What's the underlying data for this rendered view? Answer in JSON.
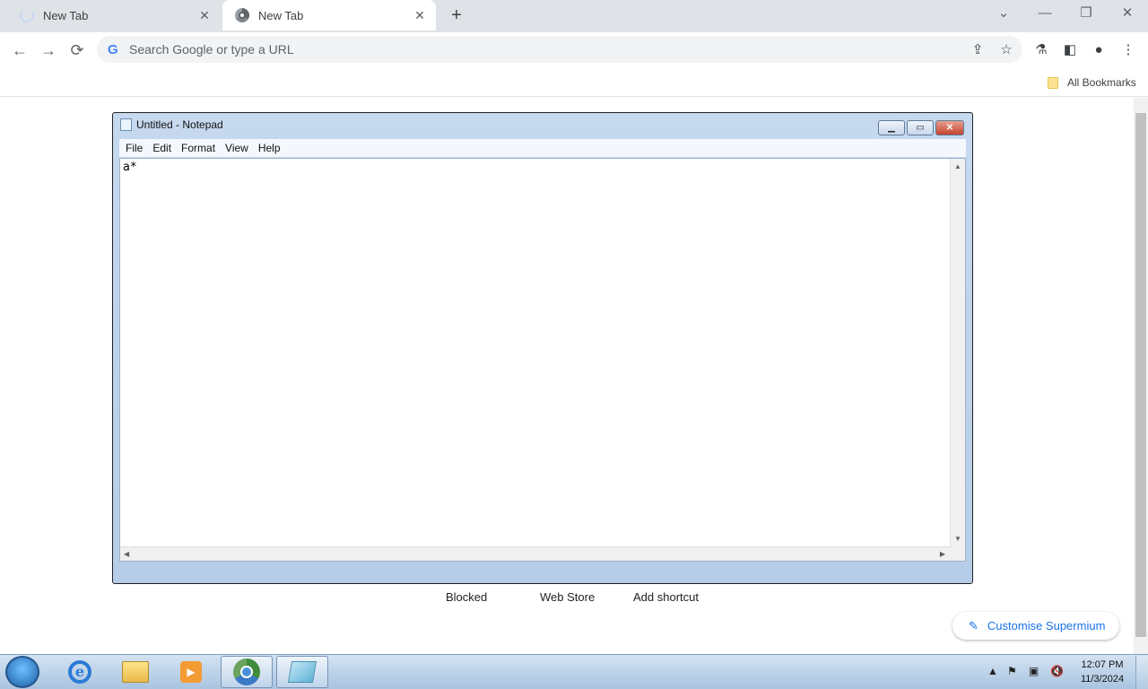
{
  "browser": {
    "tabs": [
      {
        "title": "New Tab",
        "state": "loading"
      },
      {
        "title": "New Tab",
        "state": "active"
      }
    ],
    "new_tab_symbol": "+",
    "window_controls": {
      "minimize": "—",
      "restore": "❐",
      "close": "✕",
      "dropdown": "⌄"
    },
    "omnibox": {
      "placeholder": "Search Google or type a URL",
      "value": "",
      "icon": "google-g-icon"
    },
    "bookmarks": {
      "all_bookmarks_label": "All Bookmarks"
    }
  },
  "notepad": {
    "title": "Untitled - Notepad",
    "menu": [
      "File",
      "Edit",
      "Format",
      "View",
      "Help"
    ],
    "content": "a*",
    "buttons": {
      "minimize": "▁",
      "maximize": "▭",
      "close": "✕"
    }
  },
  "new_tab_page": {
    "shortcuts": [
      "Blocked",
      "Web Store",
      "Add shortcut"
    ],
    "customise_label": "Customise Supermium"
  },
  "taskbar": {
    "clock_time": "12:07 PM",
    "clock_date": "11/3/2024",
    "apps": [
      "internet-explorer",
      "file-explorer",
      "media-player",
      "chrome",
      "notepad"
    ]
  }
}
